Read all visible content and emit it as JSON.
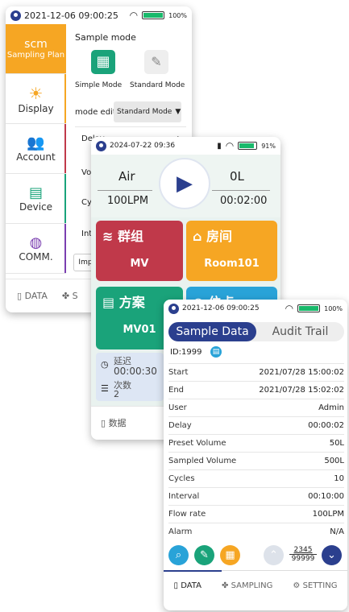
{
  "screen_a": {
    "status": {
      "time": "2021-12-06 09:00:25",
      "battery": "100%"
    },
    "sidebar": [
      {
        "label": "Sampling Plan",
        "icon": "scm"
      },
      {
        "label": "Display"
      },
      {
        "label": "Account"
      },
      {
        "label": "Device"
      },
      {
        "label": "COMM."
      }
    ],
    "sample_mode_title": "Sample mode",
    "simple_mode": "Simple Mode",
    "standard_mode": "Standard Mode",
    "mode_edit_label": "mode edit",
    "mode_edit_value": "Standard Mode",
    "menu": {
      "delay": "Delay",
      "delay_arrow": ">",
      "vo": "Vo",
      "cy": "Cy",
      "int": "Int",
      "imp": "Imp"
    },
    "bottom": {
      "data": "DATA",
      "sampling": "S"
    }
  },
  "screen_b": {
    "status": {
      "time": "2024-07-22 09:36",
      "battery": "91%"
    },
    "gas": "Air",
    "volume": "0L",
    "flow": "100LPM",
    "timer": "00:02:00",
    "tiles": {
      "group_label": "群组",
      "group_value": "MV",
      "room_label": "房间",
      "room_value": "Room101",
      "plan_label": "方案",
      "plan_value": "MV01",
      "point_label": "位点"
    },
    "delay_label": "延迟",
    "delay_value": "00:00:30",
    "times_label": "次数",
    "times_value": "2",
    "bottom": {
      "data": "数据"
    }
  },
  "screen_c": {
    "status": {
      "time": "2021-12-06 09:00:25",
      "battery": "100%"
    },
    "tabs": {
      "sample_data": "Sample Data",
      "audit_trail": "Audit Trail"
    },
    "id": "ID:1999",
    "rows": [
      {
        "k": "Start",
        "v": "2021/07/28 15:00:02"
      },
      {
        "k": "End",
        "v": "2021/07/28 15:02:02"
      },
      {
        "k": "User",
        "v": "Admin"
      },
      {
        "k": "Delay",
        "v": "00:00:02"
      },
      {
        "k": "Preset Volume",
        "v": "50L"
      },
      {
        "k": "Sampled Volume",
        "v": "500L"
      },
      {
        "k": "Cycles",
        "v": "10"
      },
      {
        "k": "Interval",
        "v": "00:10:00"
      },
      {
        "k": "Flow rate",
        "v": "100LPM"
      },
      {
        "k": "Alarm",
        "v": "N/A"
      }
    ],
    "pager": {
      "current": "2345",
      "total": "99999"
    },
    "bottom": {
      "data": "DATA",
      "sampling": "SAMPLING",
      "setting": "SETTING"
    }
  }
}
